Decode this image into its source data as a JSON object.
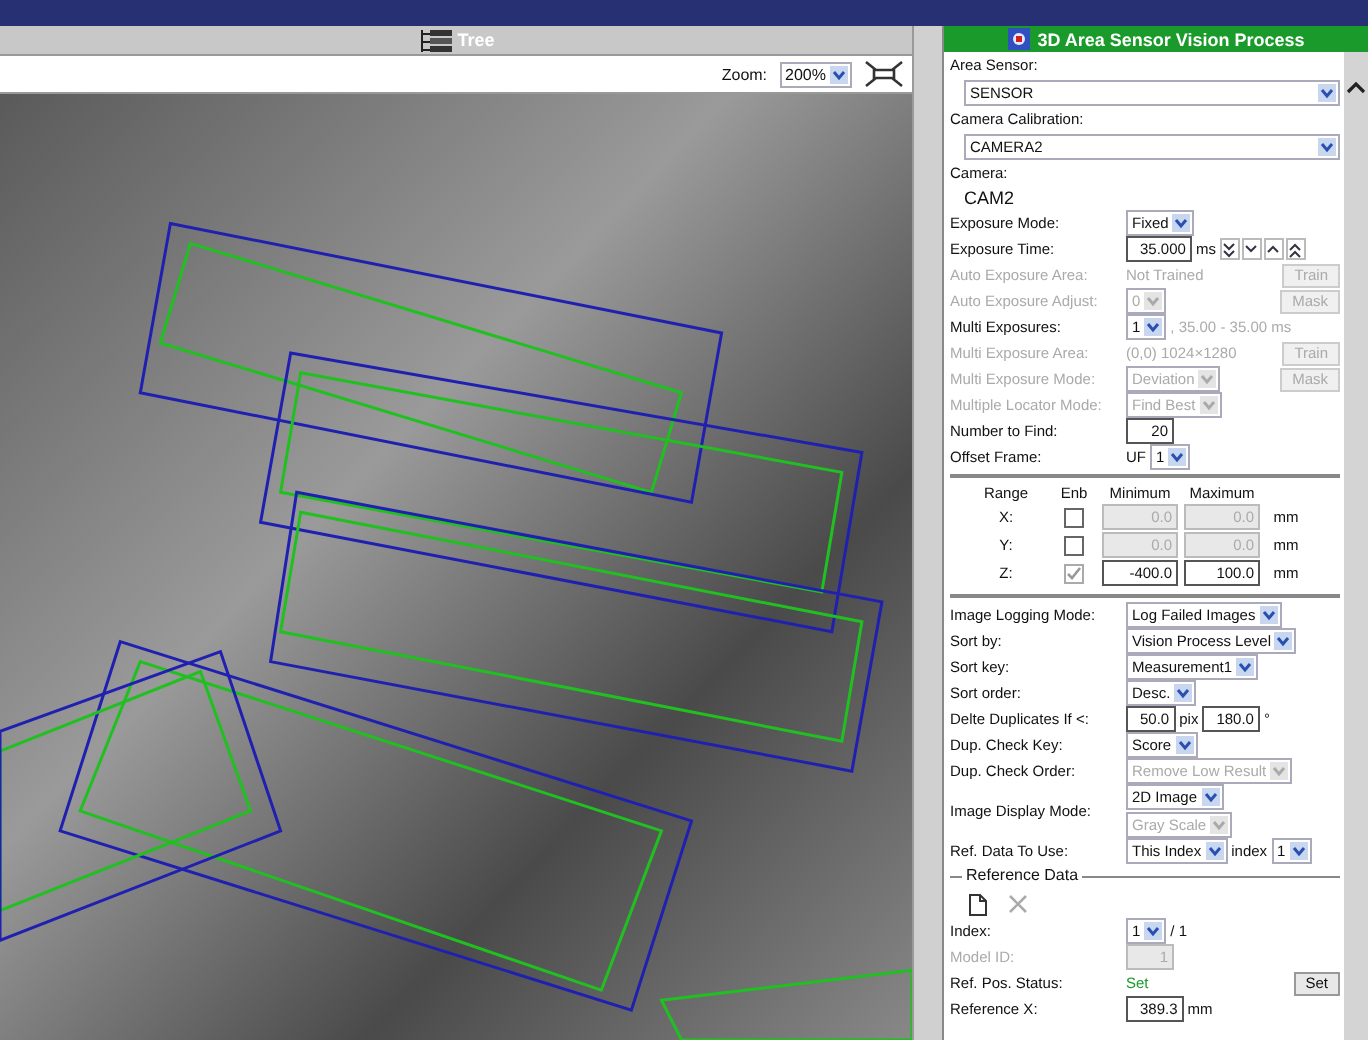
{
  "viewer": {
    "title": "Tree",
    "zoom_label": "Zoom:",
    "zoom_value": "200%"
  },
  "panel": {
    "title": "3D Area Sensor Vision Process",
    "sections": [
      {
        "kind": "fields",
        "rows": [
          {
            "label": "Area Sensor:",
            "kind": "block",
            "disabled": false,
            "controls": [
              {
                "kind": "select",
                "value": "SENSOR",
                "disabled": false
              }
            ]
          },
          {
            "label": "Camera Calibration:",
            "kind": "block",
            "disabled": false,
            "controls": [
              {
                "kind": "select",
                "value": "CAMERA2",
                "disabled": false
              }
            ]
          },
          {
            "label": "Camera:",
            "kind": "block",
            "disabled": false,
            "controls": [
              {
                "kind": "text",
                "value": "CAM2",
                "disabled": false
              }
            ]
          },
          {
            "label": "Exposure Mode:",
            "kind": "inline",
            "disabled": false,
            "controls": [
              {
                "kind": "select",
                "value": "Fixed",
                "disabled": false
              }
            ]
          },
          {
            "label": "Exposure Time:",
            "kind": "inline",
            "disabled": false,
            "controls": [
              {
                "kind": "input",
                "value": "35.000",
                "disabled": false
              },
              {
                "kind": "text",
                "value": "ms",
                "disabled": false
              },
              {
                "kind": "steps"
              }
            ]
          },
          {
            "label": "Auto Exposure Area:",
            "kind": "inline",
            "disabled": true,
            "controls": [
              {
                "kind": "text",
                "value": "Not Trained",
                "disabled": true
              },
              {
                "kind": "button",
                "value": "Train",
                "disabled": true
              }
            ]
          },
          {
            "label": "Auto Exposure Adjust:",
            "kind": "inline",
            "disabled": true,
            "controls": [
              {
                "kind": "select",
                "value": "0",
                "disabled": true
              },
              {
                "kind": "button",
                "value": "Mask",
                "disabled": true
              }
            ]
          },
          {
            "label": "Multi Exposures:",
            "kind": "inline",
            "disabled": false,
            "controls": [
              {
                "kind": "select",
                "value": "1",
                "disabled": false
              },
              {
                "kind": "text",
                "value": ", 35.00 - 35.00 ms",
                "disabled": true
              }
            ]
          },
          {
            "label": "Multi Exposure Area:",
            "kind": "inline",
            "disabled": true,
            "controls": [
              {
                "kind": "text",
                "value": "(0,0) 1024×1280",
                "disabled": true
              },
              {
                "kind": "button",
                "value": "Train",
                "disabled": true
              }
            ]
          },
          {
            "label": "Multi Exposure Mode:",
            "kind": "inline",
            "disabled": true,
            "controls": [
              {
                "kind": "select",
                "value": "Deviation",
                "disabled": true
              },
              {
                "kind": "button",
                "value": "Mask",
                "disabled": true
              }
            ]
          },
          {
            "label": "Multiple Locator Mode:",
            "kind": "inline",
            "disabled": true,
            "controls": [
              {
                "kind": "select",
                "value": "Find Best",
                "disabled": true
              }
            ]
          },
          {
            "label": "Number to Find:",
            "kind": "inline",
            "disabled": false,
            "controls": [
              {
                "kind": "input",
                "value": "20",
                "disabled": false
              }
            ]
          },
          {
            "label": "Offset Frame:",
            "kind": "inline",
            "disabled": false,
            "controls": [
              {
                "kind": "text",
                "value": "UF",
                "disabled": false
              },
              {
                "kind": "select",
                "value": "1",
                "disabled": false
              }
            ]
          }
        ]
      },
      {
        "kind": "range",
        "headers": [
          "Range",
          "Enb",
          "Minimum",
          "Maximum"
        ],
        "rows": [
          {
            "axis": "X:",
            "checked": false,
            "min": "0.0",
            "max": "0.0",
            "unit": "mm"
          },
          {
            "axis": "Y:",
            "checked": false,
            "min": "0.0",
            "max": "0.0",
            "unit": "mm"
          },
          {
            "axis": "Z:",
            "checked": true,
            "min": "-400.0",
            "max": "100.0",
            "unit": "mm"
          }
        ]
      },
      {
        "kind": "fields",
        "rows": [
          {
            "label": "Image Logging Mode:",
            "kind": "inline",
            "disabled": false,
            "controls": [
              {
                "kind": "select",
                "value": "Log Failed Images",
                "disabled": false
              }
            ]
          },
          {
            "label": "Sort by:",
            "kind": "inline",
            "disabled": false,
            "controls": [
              {
                "kind": "select",
                "value": "Vision Process Level",
                "disabled": false
              }
            ]
          },
          {
            "label": "Sort key:",
            "kind": "inline",
            "disabled": false,
            "controls": [
              {
                "kind": "select",
                "value": "Measurement1",
                "disabled": false
              }
            ]
          },
          {
            "label": "Sort order:",
            "kind": "inline",
            "disabled": false,
            "controls": [
              {
                "kind": "select",
                "value": "Desc.",
                "disabled": false
              }
            ]
          },
          {
            "label": "Delte Duplicates If <:",
            "kind": "inline",
            "disabled": false,
            "controls": [
              {
                "kind": "input",
                "value": "50.0",
                "disabled": false
              },
              {
                "kind": "text",
                "value": "pix",
                "disabled": false
              },
              {
                "kind": "input",
                "value": "180.0",
                "disabled": false
              },
              {
                "kind": "text",
                "value": "°",
                "disabled": false
              }
            ]
          },
          {
            "label": "Dup. Check Key:",
            "kind": "inline",
            "disabled": false,
            "controls": [
              {
                "kind": "select",
                "value": "Score",
                "disabled": false
              }
            ]
          },
          {
            "label": "Dup. Check Order:",
            "kind": "inline",
            "disabled": false,
            "controls": [
              {
                "kind": "select",
                "value": "Remove Low Result",
                "disabled": true
              }
            ]
          },
          {
            "label": "Image Display Mode:",
            "kind": "stacked",
            "disabled": false,
            "controls": [
              {
                "kind": "select",
                "value": "2D Image",
                "disabled": false
              },
              {
                "kind": "select",
                "value": "Gray Scale",
                "disabled": true
              }
            ]
          },
          {
            "label": "Ref. Data To Use:",
            "kind": "inline",
            "disabled": false,
            "controls": [
              {
                "kind": "select",
                "value": "This Index",
                "disabled": false
              },
              {
                "kind": "text",
                "value": "index",
                "disabled": false
              },
              {
                "kind": "select",
                "value": "1",
                "disabled": false
              }
            ]
          }
        ]
      },
      {
        "kind": "reference",
        "legend": "Reference Data",
        "tools": [
          {
            "kind": "new",
            "disabled": false
          },
          {
            "kind": "delete",
            "disabled": true
          }
        ],
        "rows": [
          {
            "label": "Index:",
            "kind": "inline",
            "disabled": false,
            "controls": [
              {
                "kind": "select",
                "value": "1",
                "disabled": false
              },
              {
                "kind": "text",
                "value": "/ 1",
                "disabled": false
              }
            ]
          },
          {
            "label": "Model ID:",
            "kind": "inline",
            "disabled": true,
            "controls": [
              {
                "kind": "input",
                "value": "1",
                "disabled": true
              }
            ]
          },
          {
            "label": "Ref. Pos. Status:",
            "kind": "inline",
            "disabled": false,
            "controls": [
              {
                "kind": "status",
                "value": "Set"
              },
              {
                "kind": "button",
                "value": "Set",
                "disabled": false
              }
            ]
          },
          {
            "label": "Reference X:",
            "kind": "inline",
            "disabled": false,
            "controls": [
              {
                "kind": "input",
                "value": "389.3",
                "disabled": false
              },
              {
                "kind": "text",
                "value": "mm",
                "disabled": false
              }
            ]
          }
        ]
      }
    ]
  }
}
